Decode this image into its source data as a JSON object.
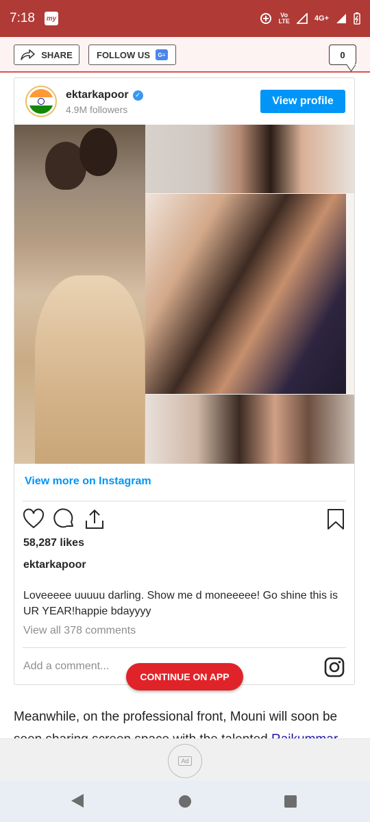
{
  "status_bar": {
    "time": "7:18",
    "app_badge": "my",
    "volte_label_line1": "Vo",
    "volte_label_line2": "LTE",
    "network_label": "4G+"
  },
  "toolbar": {
    "share_label": "SHARE",
    "follow_label": "FOLLOW US",
    "google_news_badge": "G≡",
    "comment_count": "0"
  },
  "instagram_embed": {
    "username": "ektarkapoor",
    "verified_mark": "✓",
    "followers": "4.9M followers",
    "view_profile_label": "View profile",
    "view_more_label": "View more on Instagram",
    "likes": "58,287 likes",
    "caption_username": "ektarkapoor",
    "caption_text": "Loveeeee uuuuu darling. Show me d moneeeee! Go shine this is UR YEAR!happie bdayyyy",
    "view_comments": "View all 378 comments",
    "add_comment_placeholder": "Add a comment...",
    "accent_color": "#0095f6"
  },
  "continue_on_app_label": "CONTINUE ON APP",
  "article": {
    "text": "Meanwhile, on the professional front, Mouni will soon be seen sharing screen space with the talented ",
    "link_text": "Rajkummar"
  },
  "ad": {
    "badge": "Ad"
  },
  "colors": {
    "status_bar": "#b03a35",
    "continue_button": "#e02328"
  }
}
